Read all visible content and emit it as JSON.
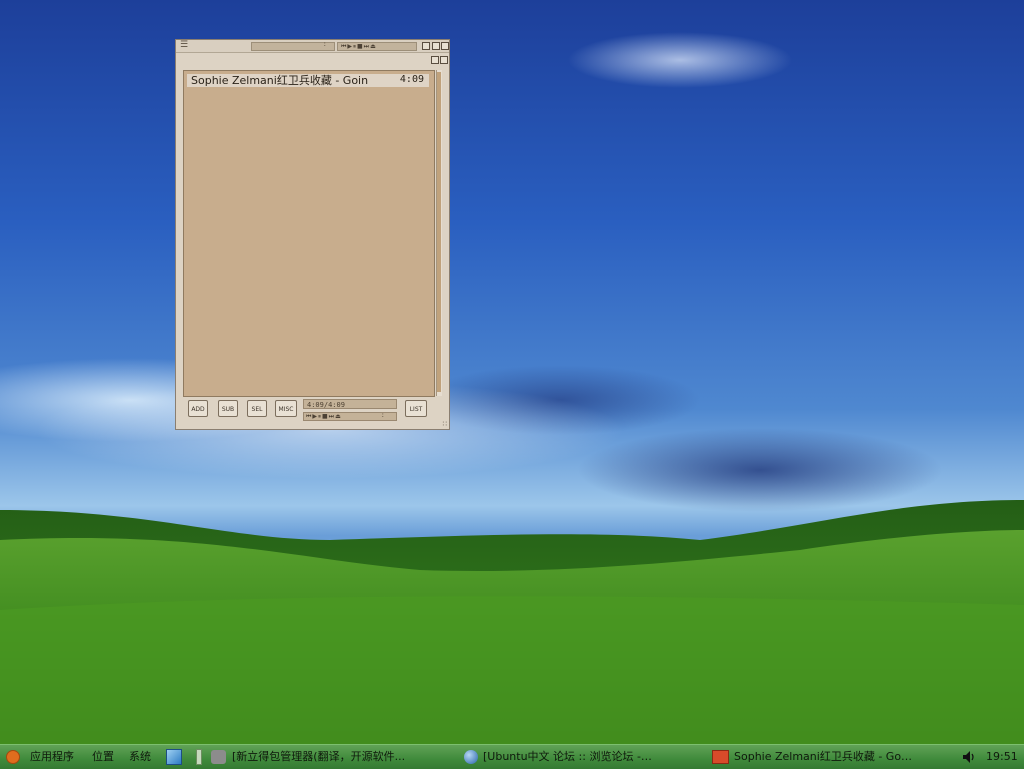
{
  "player": {
    "playlist": [
      {
        "title": "Sophie Zelmani红卫兵收藏 - Goin",
        "time": "4:09"
      }
    ],
    "buttons": {
      "add": "ADD",
      "sub": "SUB",
      "sel": "SEL",
      "misc": "MISC",
      "list": "LIST"
    },
    "time_display": "4:09/4:09",
    "titlebar_field": ":",
    "ctrl_field": ":"
  },
  "taskbar": {
    "menus": {
      "applications": "应用程序",
      "places": "位置",
      "system": "系统"
    },
    "tasks": [
      {
        "label": "[新立得包管理器(翻译，开源软件..."
      },
      {
        "label": "[Ubuntu中文 论坛 :: 浏览论坛 -…"
      },
      {
        "label": "Sophie Zelmani红卫兵收藏 - Go…"
      }
    ],
    "clock": "19:51"
  },
  "colors": {
    "taskbar": "#3f8a3b",
    "player_bg": "#ddd3c4",
    "playlist_bg": "#c8ad8d"
  }
}
